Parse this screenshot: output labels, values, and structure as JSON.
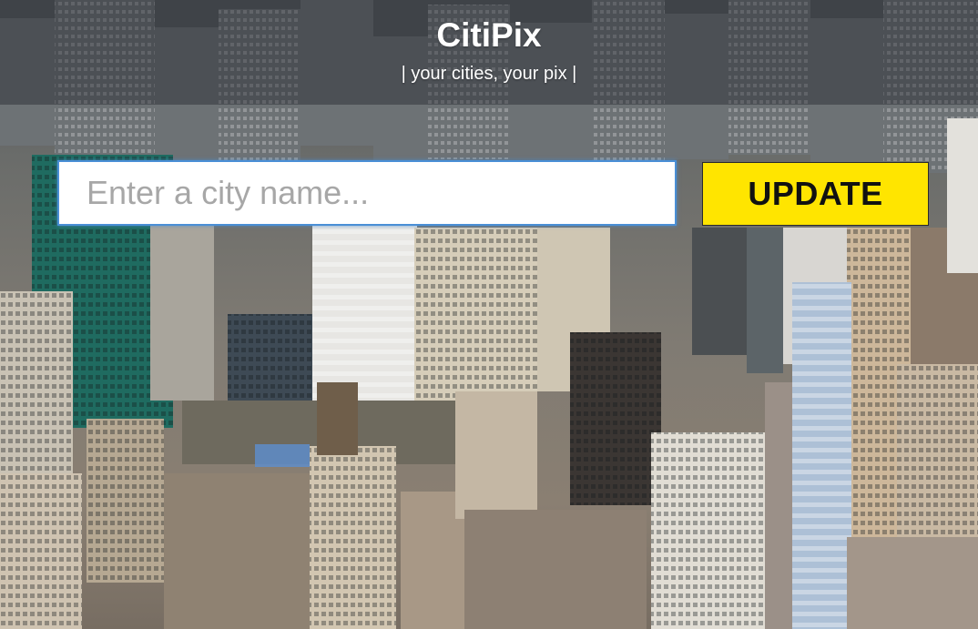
{
  "header": {
    "title": "CitiPix",
    "tagline": "| your cities, your pix |"
  },
  "search": {
    "placeholder": "Enter a city name...",
    "value": ""
  },
  "actions": {
    "update_label": "UPDATE"
  },
  "colors": {
    "button_bg": "#ffe500",
    "input_border": "#4a8fd6",
    "header_overlay": "rgba(30,34,40,0.42)"
  }
}
